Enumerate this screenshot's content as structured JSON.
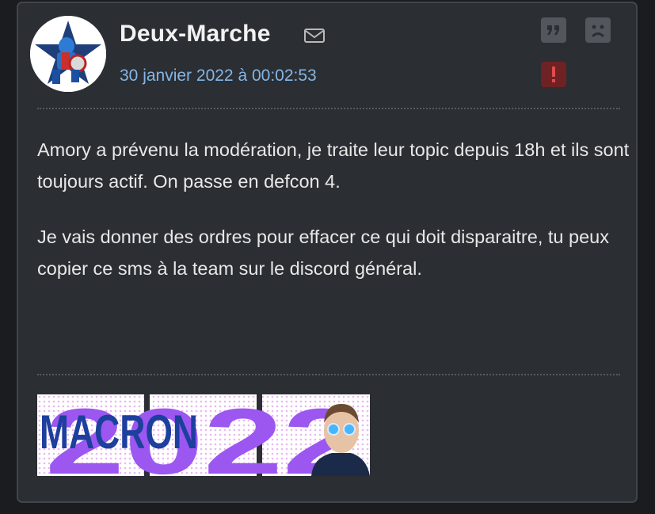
{
  "post": {
    "author": "Deux-Marche",
    "date": "30 janvier 2022 à 00:02:53",
    "paragraphs": [
      "Amory a prévenu la modération, je traite leur topic depuis 18h et ils sont toujours actif. On passe en defcon 4.",
      "Je vais donner des ordres pour effacer ce qui doit disparaitre, tu peux copier ce sms à la team sur le discord général."
    ],
    "signature": {
      "word": "MACRON",
      "year": "2022"
    }
  },
  "icons": {
    "avatar": "superhero-star-avatar",
    "mail": "envelope-icon",
    "quote": "quote-icon",
    "sad": "sad-face-icon",
    "report": "exclamation-icon"
  },
  "colors": {
    "background": "#2b2e33",
    "date": "#83b6e6",
    "report": "#6e2223",
    "signature_blue": "#1d3f9e",
    "signature_purple": "#9b57f0"
  }
}
